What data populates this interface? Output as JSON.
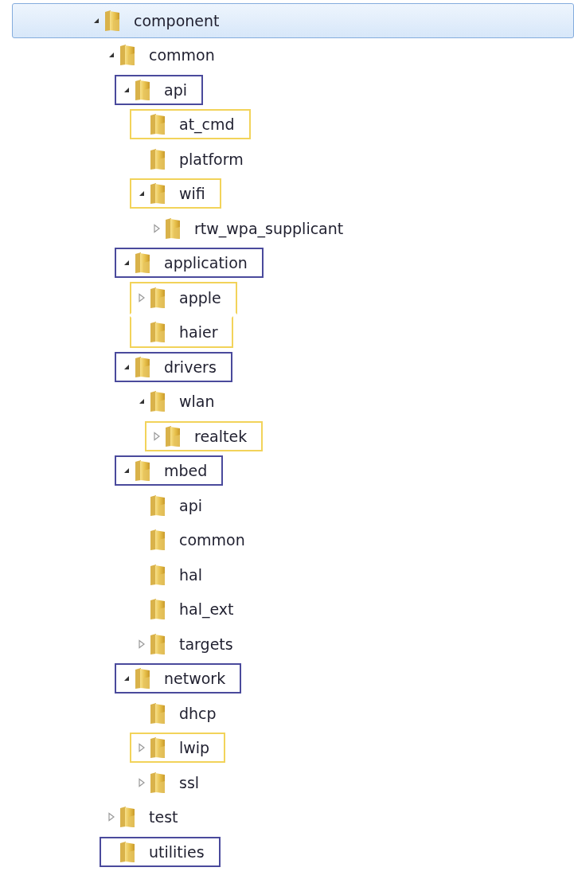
{
  "tree": [
    {
      "label": "component",
      "kind": "open",
      "selected": true,
      "children": [
        {
          "label": "common",
          "kind": "open",
          "selected": false,
          "children": [
            {
              "label": "api",
              "kind": "open",
              "selected": false,
              "color": "#4a4a9c",
              "children": [
                {
                  "label": "at_cmd",
                  "kind": "leaf",
                  "selected": false,
                  "color": "#f2d35a"
                },
                {
                  "label": "platform",
                  "kind": "leaf",
                  "selected": false
                },
                {
                  "label": "wifi",
                  "kind": "open",
                  "selected": false,
                  "color": "#f2d35a",
                  "children": [
                    {
                      "label": "rtw_wpa_supplicant",
                      "kind": "closed",
                      "selected": false
                    }
                  ]
                }
              ]
            },
            {
              "label": "application",
              "kind": "open",
              "selected": false,
              "color": "#4a4a9c",
              "children": [
                {
                  "label": "apple",
                  "kind": "closed",
                  "selected": false,
                  "color": "#f2d35a"
                },
                {
                  "label": "haier",
                  "kind": "leaf",
                  "selected": false,
                  "color": "#f2d35a"
                }
              ]
            },
            {
              "label": "drivers",
              "kind": "open",
              "selected": false,
              "color": "#4a4a9c",
              "children": [
                {
                  "label": "wlan",
                  "kind": "open",
                  "selected": false,
                  "children": [
                    {
                      "label": "realtek",
                      "kind": "closed",
                      "selected": false,
                      "color": "#f2d35a"
                    }
                  ]
                }
              ]
            },
            {
              "label": "mbed",
              "kind": "open",
              "selected": false,
              "color": "#4a4a9c",
              "children": [
                {
                  "label": "api",
                  "kind": "leaf",
                  "selected": false
                },
                {
                  "label": "common",
                  "kind": "leaf",
                  "selected": false
                },
                {
                  "label": "hal",
                  "kind": "leaf",
                  "selected": false
                },
                {
                  "label": "hal_ext",
                  "kind": "leaf",
                  "selected": false
                },
                {
                  "label": "targets",
                  "kind": "closed",
                  "selected": false
                }
              ]
            },
            {
              "label": "network",
              "kind": "open",
              "selected": false,
              "color": "#4a4a9c",
              "children": [
                {
                  "label": "dhcp",
                  "kind": "leaf",
                  "selected": false
                },
                {
                  "label": "lwip",
                  "kind": "closed",
                  "selected": false,
                  "color": "#f2d35a"
                },
                {
                  "label": "ssl",
                  "kind": "closed",
                  "selected": false
                }
              ]
            }
          ]
        },
        {
          "label": "test",
          "kind": "closed",
          "selected": false
        },
        {
          "label": "utilities",
          "kind": "leaf",
          "selected": false,
          "color": "#4a4a9c"
        }
      ]
    }
  ]
}
